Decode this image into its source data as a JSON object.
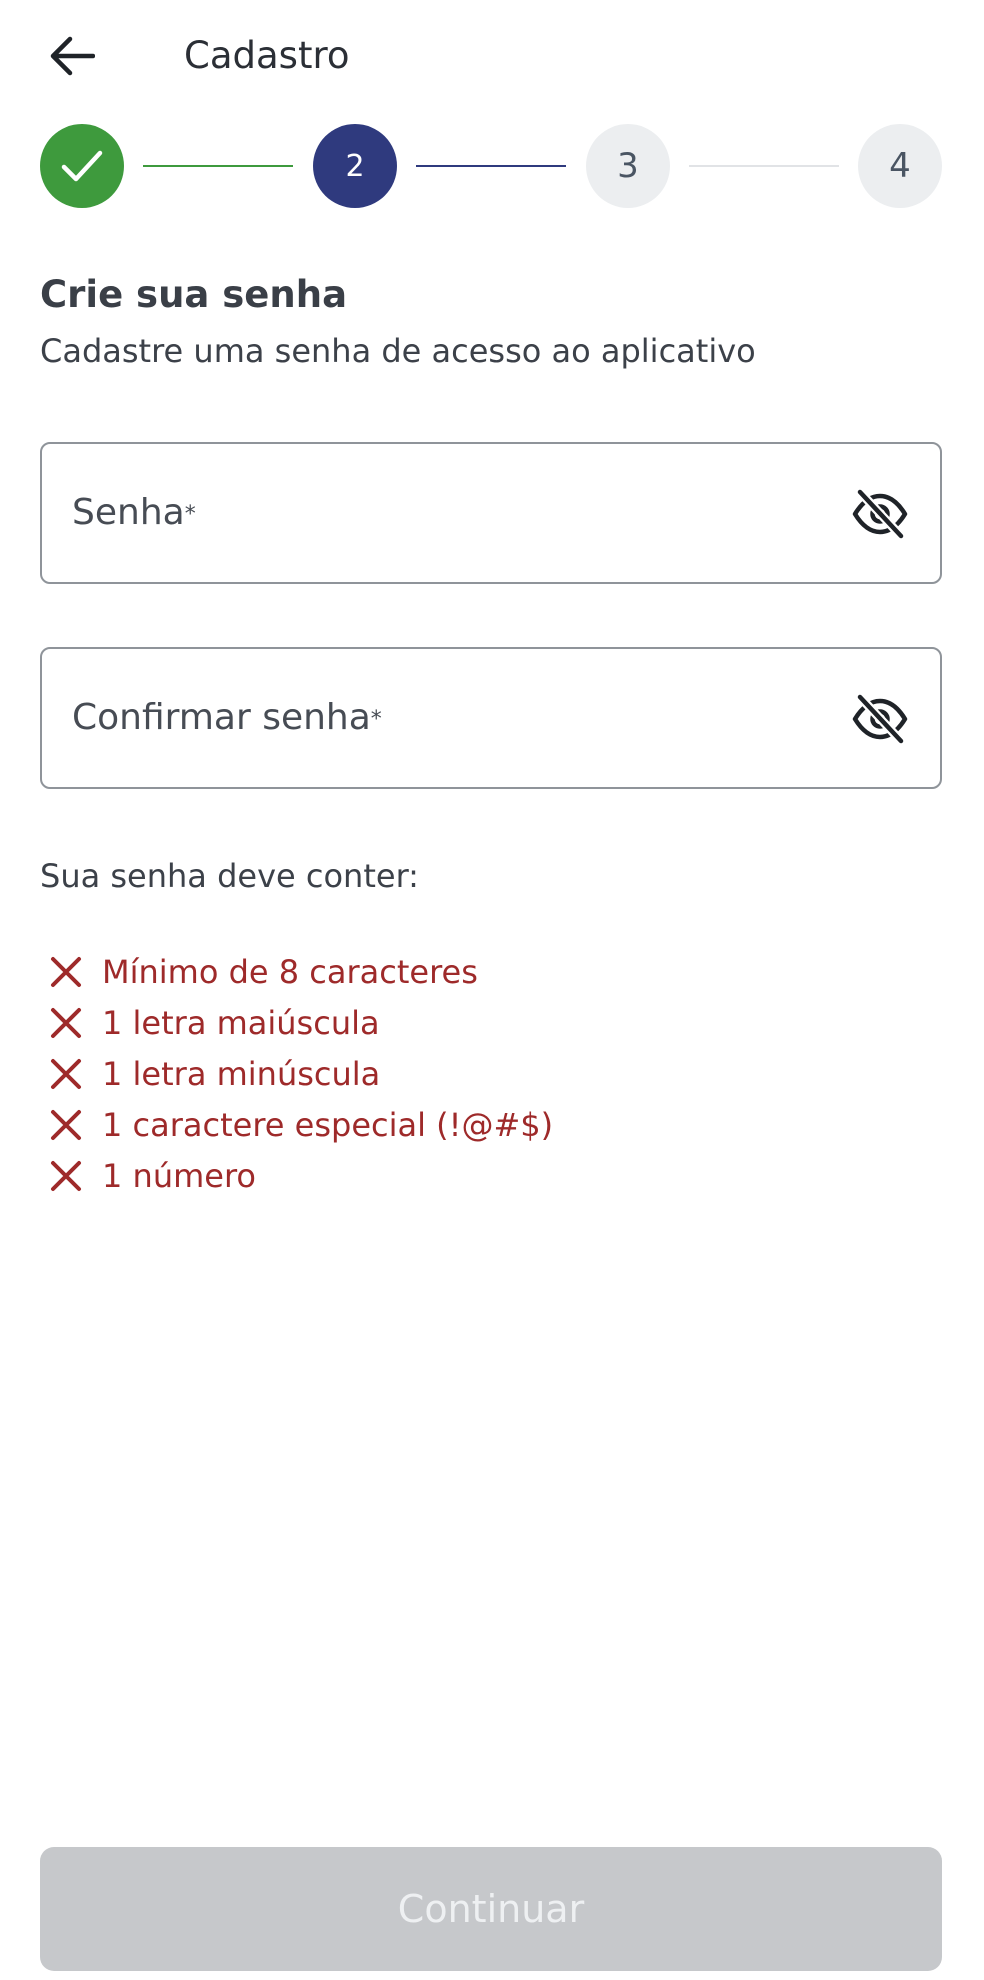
{
  "header": {
    "title": "Cadastro",
    "back_icon": "arrow-left-icon"
  },
  "stepper": {
    "steps": [
      {
        "label": "",
        "state": "completed",
        "icon": "check-icon",
        "color": "#3e9a3d"
      },
      {
        "label": "2",
        "state": "current",
        "color": "#2f3a7e"
      },
      {
        "label": "3",
        "state": "upcoming",
        "color": "#eceef0"
      },
      {
        "label": "4",
        "state": "upcoming",
        "color": "#eceef0"
      }
    ]
  },
  "intro": {
    "title": "Crie sua senha",
    "subtitle": "Cadastre uma senha de acesso ao aplicativo"
  },
  "fields": {
    "password": {
      "label": "Senha",
      "required_mark": "*",
      "value": "",
      "toggle_icon": "eye-off-icon"
    },
    "confirm": {
      "label": "Confirmar senha",
      "required_mark": "*",
      "value": "",
      "toggle_icon": "eye-off-icon"
    }
  },
  "requirements": {
    "heading": "Sua senha deve conter:",
    "status_color": "#9e2a2a",
    "items": [
      {
        "text": "Mínimo de 8 caracteres",
        "met": false
      },
      {
        "text": "1 letra maiúscula",
        "met": false
      },
      {
        "text": "1 letra minúscula",
        "met": false
      },
      {
        "text": "1 caractere especial (!@#$)",
        "met": false
      },
      {
        "text": "1 número",
        "met": false
      }
    ]
  },
  "actions": {
    "continue_label": "Continuar",
    "continue_enabled": false
  }
}
